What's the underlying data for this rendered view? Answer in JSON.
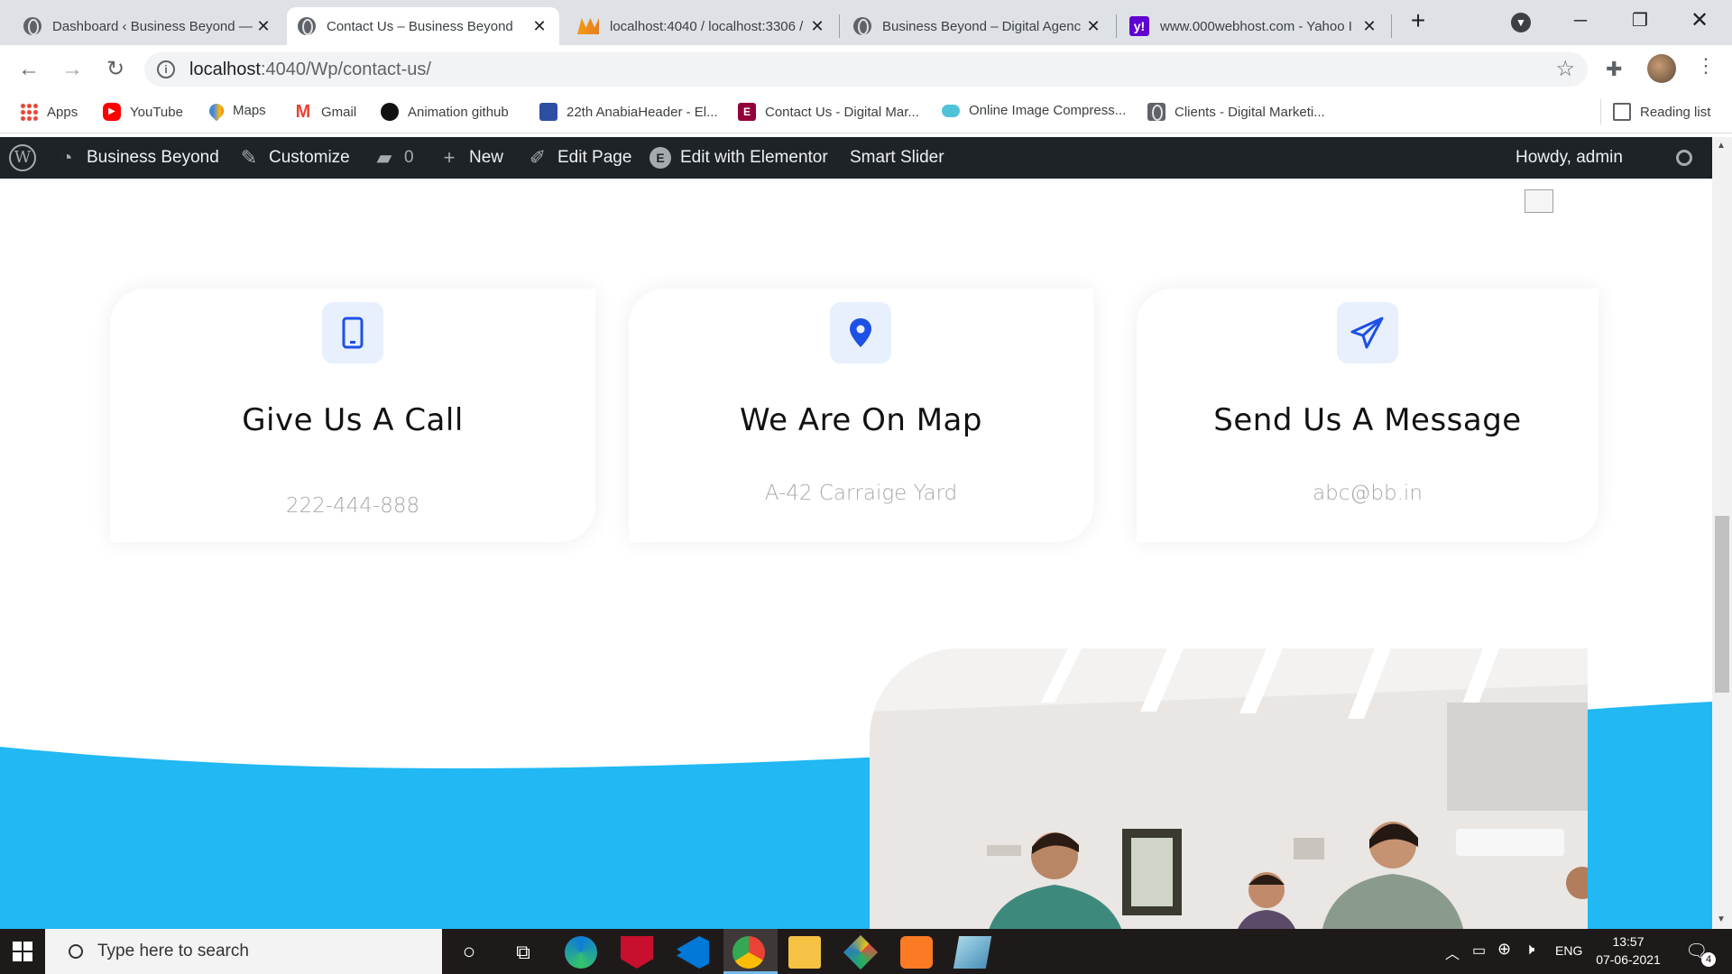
{
  "browser": {
    "tabs": [
      {
        "title": "Dashboard ‹ Business Beyond —",
        "active": false
      },
      {
        "title": "Contact Us – Business Beyond",
        "active": true
      },
      {
        "title": "localhost:4040 / localhost:3306 /",
        "active": false
      },
      {
        "title": "Business Beyond – Digital Agenc",
        "active": false
      },
      {
        "title": "www.000webhost.com - Yahoo I",
        "active": false
      }
    ],
    "url_host": "localhost",
    "url_path": ":4040/Wp/contact-us/",
    "bookmarks": [
      {
        "label": "Apps",
        "icon": "apps-grid-icon"
      },
      {
        "label": "YouTube",
        "icon": "youtube-icon"
      },
      {
        "label": "Maps",
        "icon": "maps-pin-icon"
      },
      {
        "label": "Gmail",
        "icon": "gmail-icon"
      },
      {
        "label": "Animation github",
        "icon": "github-icon"
      },
      {
        "label": "22th AnabiaHeader - El...",
        "icon": "bookmark-site-icon"
      },
      {
        "label": "Contact Us - Digital Mar...",
        "icon": "elementor-icon"
      },
      {
        "label": "Online Image Compress...",
        "icon": "cloud-icon"
      },
      {
        "label": "Clients - Digital Marketi...",
        "icon": "globe-icon"
      }
    ],
    "reading_list": "Reading list"
  },
  "wp_admin_bar": {
    "site_name": "Business Beyond",
    "customize": "Customize",
    "comments_count": "0",
    "new": "New",
    "edit_page": "Edit Page",
    "edit_elementor": "Edit with Elementor",
    "smart_slider": "Smart Slider",
    "howdy": "Howdy, admin"
  },
  "contact_cards": [
    {
      "title": "Give Us A Call",
      "value": "222-444-888",
      "icon": "mobile-phone-icon"
    },
    {
      "title": "We Are On Map",
      "value": "A-42 Carraige Yard",
      "icon": "map-pin-icon"
    },
    {
      "title": "Send Us A Message",
      "value": "abc@bb.in",
      "icon": "paper-plane-icon"
    }
  ],
  "taskbar": {
    "search_placeholder": "Type here to search",
    "language": "ENG",
    "time": "13:57",
    "date": "07-06-2021",
    "notification_count": "4"
  },
  "colors": {
    "accent_blue": "#1e50e6",
    "wave_blue": "#21b8f4",
    "wp_bar": "#1d2327"
  }
}
